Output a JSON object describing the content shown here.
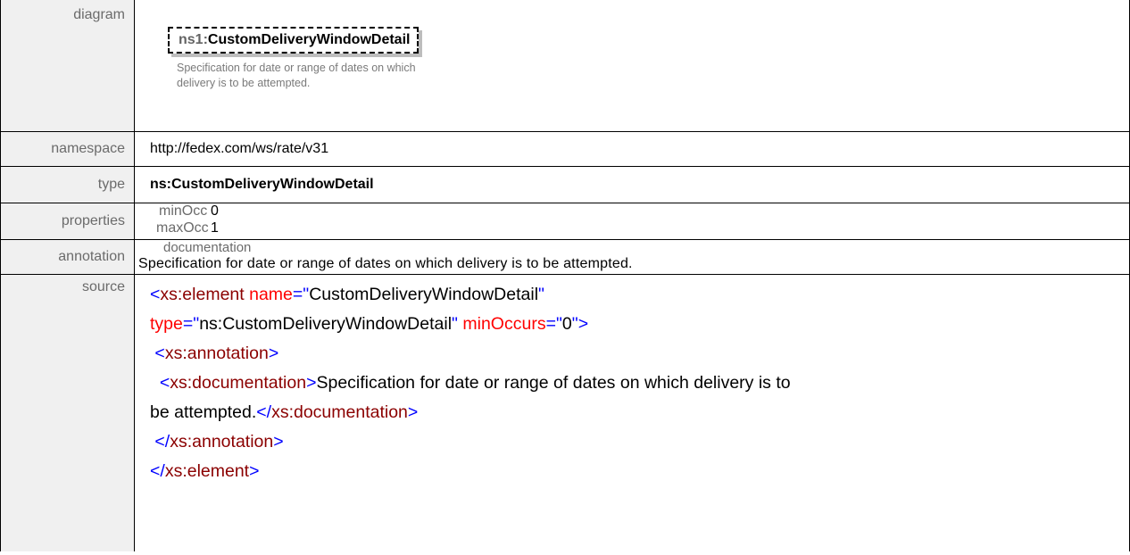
{
  "labels": {
    "diagram": "diagram",
    "namespace": "namespace",
    "type": "type",
    "properties": "properties",
    "annotation": "annotation",
    "source": "source"
  },
  "diagram": {
    "prefix": "ns1:",
    "name": "CustomDeliveryWindowDetail",
    "note": "Specification for date or range of dates on which delivery is to be attempted."
  },
  "namespace": "http://fedex.com/ws/rate/v31",
  "type": "ns:CustomDeliveryWindowDetail",
  "properties": {
    "minOcc_label": "minOcc",
    "minOcc_value": "0",
    "maxOcc_label": "maxOcc",
    "maxOcc_value": "1"
  },
  "annotation": {
    "label": "documentation",
    "text": "Specification  for date or range of dates on which delivery is to be attempted."
  },
  "source": {
    "open_lt": "<",
    "xs_element": "xs:element",
    "attr_name": "name",
    "eq": "=",
    "q": "\"",
    "name_value": "CustomDeliveryWindowDetail",
    "attr_type": "type",
    "type_value": "ns:CustomDeliveryWindowDetail",
    "attr_minOccurs": "minOccurs",
    "minOccurs_value": "0",
    "gt": ">",
    "xs_annotation": "xs:annotation",
    "xs_documentation": "xs:documentation",
    "doc_text_1": "Specification for date or range of dates on which delivery is to",
    "doc_text_2": "be attempted.",
    "close_lt": "</"
  }
}
